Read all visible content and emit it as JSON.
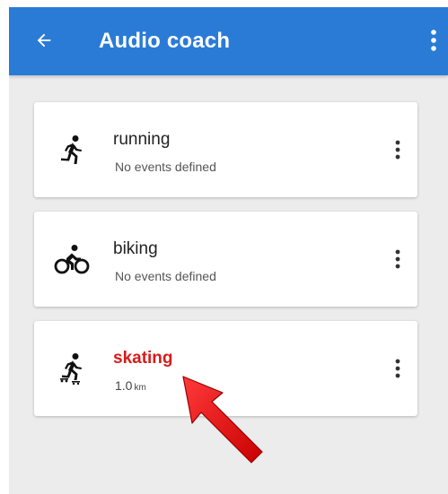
{
  "appbar": {
    "title": "Audio coach",
    "back_icon": "arrow-left-icon",
    "menu_icon": "more-vertical-icon",
    "color": "#2a7bd6"
  },
  "activities": [
    {
      "name": "running",
      "subtitle": "No events defined",
      "icon": "running-person-icon"
    },
    {
      "name": "biking",
      "subtitle": "No events defined",
      "icon": "cyclist-icon"
    },
    {
      "name": "skating",
      "value": "1.0",
      "unit": "km",
      "icon": "skater-icon",
      "highlight_color": "#d81b1b"
    }
  ],
  "annotation": {
    "icon": "red-arrow-icon",
    "color": "#e01010"
  }
}
